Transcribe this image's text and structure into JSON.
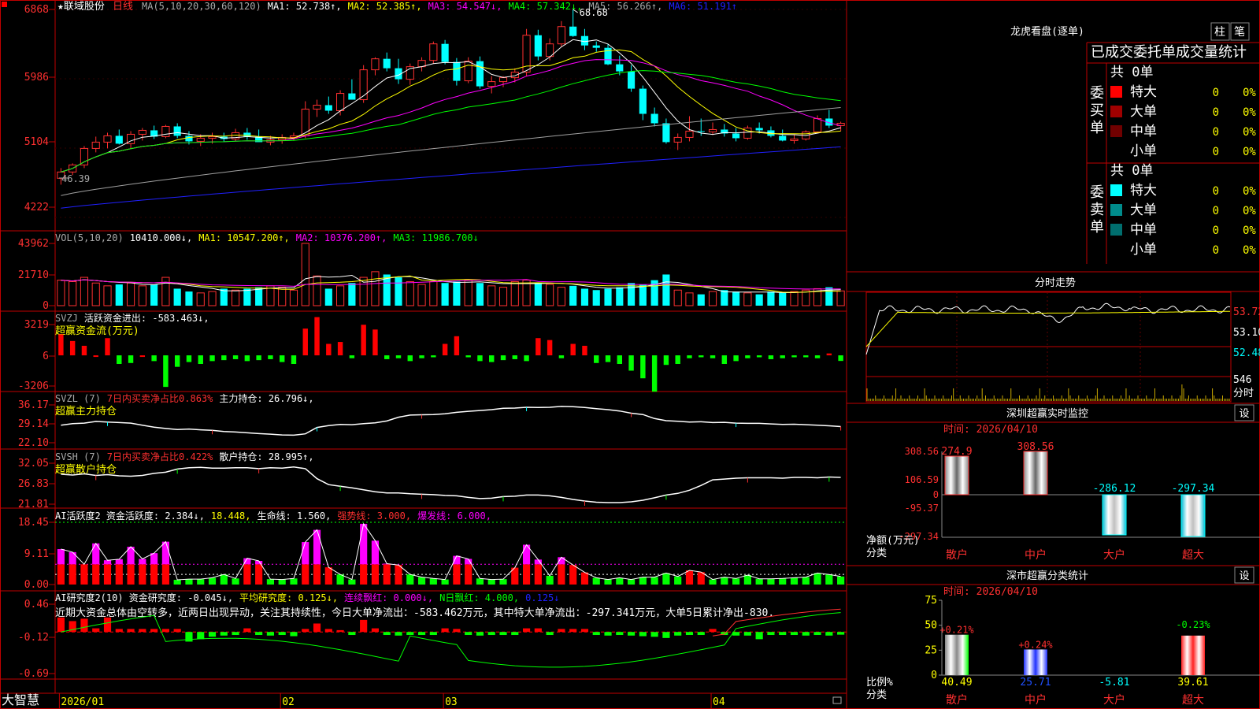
{
  "stock": {
    "name": "★联域股份",
    "period": "日线"
  },
  "colors": {
    "up": "#ff3030",
    "down": "#00ffff",
    "frame": "#c00000",
    "ma1": "#ffffff",
    "ma2": "#ffff00",
    "ma3": "#ff00ff",
    "ma4": "#00ff00",
    "ma5": "#a0a0a0",
    "ma6": "#2020ff",
    "green": "#00ff00",
    "magenta": "#ff00ff",
    "yellow": "#ffff00",
    "cyan": "#00ffff",
    "text": "#ffffff",
    "grey": "#aaaaaa"
  },
  "price_panel": {
    "header": [
      {
        "t": "MA(5,10,20,30,60,120)",
        "c": "grey"
      },
      {
        "t": "MA1: 52.738↑,",
        "c": "ma1"
      },
      {
        "t": "MA2: 52.385↑,",
        "c": "ma2"
      },
      {
        "t": "MA3: 54.547↓,",
        "c": "ma3"
      },
      {
        "t": "MA4: 57.342↓,",
        "c": "ma4"
      },
      {
        "t": "MA5: 56.266↑,",
        "c": "grey"
      },
      {
        "t": "MA6: 51.191↑",
        "c": "ma6"
      }
    ],
    "yticks": [
      "6868",
      "5986",
      "5104",
      "4222"
    ],
    "high_label": "68.68",
    "low_label": "46.39"
  },
  "vol_panel": {
    "header": [
      {
        "t": "VOL(5,10,20)",
        "c": "grey"
      },
      {
        "t": "10410.000↓,",
        "c": "ma1"
      },
      {
        "t": "MA1: 10547.200↑,",
        "c": "ma2"
      },
      {
        "t": "MA2: 10376.200↑,",
        "c": "ma3"
      },
      {
        "t": "MA3: 11986.700↓",
        "c": "ma4"
      }
    ],
    "yticks": [
      "43962",
      "21710",
      "0"
    ]
  },
  "svzj_panel": {
    "header": [
      {
        "t": "SVZJ",
        "c": "grey"
      },
      {
        "t": "活跃资金进出: -583.463↓,",
        "c": "text"
      }
    ],
    "subtitle": "超赢资金流(万元)",
    "yticks": [
      "3219",
      "6",
      "-3206"
    ]
  },
  "svzl_panel": {
    "header": [
      {
        "t": "SVZL (7)",
        "c": "grey"
      },
      {
        "t": "7日内买卖净占比0.863%",
        "c": "up"
      },
      {
        "t": "主力持仓: 26.796↓,",
        "c": "text"
      }
    ],
    "subtitle": "超赢主力持仓",
    "yticks": [
      "36.17",
      "29.14",
      "22.10"
    ]
  },
  "svsh_panel": {
    "header": [
      {
        "t": "SVSH (7)",
        "c": "grey"
      },
      {
        "t": "7日内买卖净占比0.422%",
        "c": "up"
      },
      {
        "t": "散户持仓: 28.995↑,",
        "c": "text"
      }
    ],
    "subtitle": "超赢散户持仓",
    "yticks": [
      "32.05",
      "26.83",
      "21.81"
    ]
  },
  "ai1_panel": {
    "header": [
      {
        "t": "AI活跃度2 资金活跃度: 2.384↓,",
        "c": "text"
      },
      {
        "t": "18.448,",
        "c": "ma2"
      },
      {
        "t": "生命线: 1.560,",
        "c": "text"
      },
      {
        "t": "强势线: 3.000,",
        "c": "up"
      },
      {
        "t": "爆发线: 6.000,",
        "c": "magenta"
      }
    ],
    "yticks": [
      "18.45",
      "9.11",
      "0.00"
    ]
  },
  "ai2_panel": {
    "header": [
      {
        "t": "AI研究度2(10) 资金研究度: -0.045↓,",
        "c": "text"
      },
      {
        "t": "平均研究度: 0.125↓,",
        "c": "ma2"
      },
      {
        "t": "连续飘红: 0.000↓,",
        "c": "magenta"
      },
      {
        "t": "N日飘红: 4.000,",
        "c": "green"
      },
      {
        "t": "0.125↓",
        "c": "ma6"
      }
    ],
    "text": "近期大资金总体由空转多，近两日出现异动，关注其持续性，今日大单净流出：-583.462万元，其中特大单净流出：-297.341万元，大单5日累计净出-830.",
    "yticks": [
      "0.46",
      "-0.12",
      "-0.69"
    ]
  },
  "xaxis": {
    "logo": "大智慧",
    "labels": [
      {
        "t": "2026/01",
        "x": 0
      },
      {
        "t": "02",
        "x": 19
      },
      {
        "t": "03",
        "x": 33
      },
      {
        "t": "04",
        "x": 56
      }
    ]
  },
  "dragon": {
    "title": "龙虎看盘(逐单)",
    "tabs": [
      "柱",
      "笔"
    ],
    "heading": "已成交委托单成交量统计",
    "buy_label": "委买单",
    "sell_label": "委卖单",
    "buy_total": "共 0单",
    "sell_total": "共 0单",
    "buy_rows": [
      {
        "name": "特大",
        "vol": "0",
        "pct": "0%",
        "color": "#ff0000"
      },
      {
        "name": "大单",
        "vol": "0",
        "pct": "0%",
        "color": "#a00000"
      },
      {
        "name": "中单",
        "vol": "0",
        "pct": "0%",
        "color": "#700000"
      },
      {
        "name": "小单",
        "vol": "0",
        "pct": "0%",
        "color": ""
      }
    ],
    "sell_rows": [
      {
        "name": "特大",
        "vol": "0",
        "pct": "0%",
        "color": "#00ffff"
      },
      {
        "name": "大单",
        "vol": "0",
        "pct": "0%",
        "color": "#008c8c"
      },
      {
        "name": "中单",
        "vol": "0",
        "pct": "0%",
        "color": "#006e6e"
      },
      {
        "name": "小单",
        "vol": "0",
        "pct": "0%",
        "color": ""
      }
    ]
  },
  "minute": {
    "title": "分时走势",
    "ylabels": [
      "53.72",
      "53.10",
      "52.48"
    ],
    "vol_label": "546",
    "vol_unit": "分时"
  },
  "sz_monitor": {
    "title": "深圳超赢实时监控",
    "settings": "设",
    "time": "时间: 2026/04/10",
    "yticks": [
      "308.56",
      "106.59",
      "0",
      "-95.37",
      "-297.34"
    ],
    "ylabel": "净额(万元)",
    "xlabel": "分类",
    "cats": [
      "散户",
      "中户",
      "大户",
      "超大"
    ],
    "vals": [
      274.9,
      308.56,
      -286.12,
      -297.34
    ],
    "val_labels": [
      "274.9",
      "308.56",
      "-286.12",
      "-297.34"
    ]
  },
  "sz_class": {
    "title": "深市超赢分类统计",
    "settings": "设",
    "time": "时间: 2026/04/10",
    "yticks": [
      "75",
      "50",
      "25",
      "0"
    ],
    "ylabel": "比例%",
    "xlabel": "分类",
    "cats": [
      "散户",
      "中户",
      "大户",
      "超大"
    ],
    "vals": [
      40.49,
      25.71,
      -5.81,
      39.61
    ],
    "val_labels": [
      "40.49",
      "25.71",
      "-5.81",
      "39.61"
    ],
    "chg_labels": [
      "+0.21%",
      "+0.24%",
      "",
      "-0.23%"
    ]
  },
  "chart_data": [
    {
      "type": "candlestick",
      "title": "联域股份 日线",
      "x": [
        "2026/01",
        "02",
        "03",
        "04"
      ],
      "ylim": [
        42.22,
        68.68
      ],
      "ohlc": [
        [
          47.2,
          48.5,
          46.39,
          48.0
        ],
        [
          48.0,
          49.1,
          47.6,
          48.9
        ],
        [
          48.9,
          51.3,
          48.5,
          51.0
        ],
        [
          51.0,
          52.5,
          50.5,
          51.8
        ],
        [
          51.8,
          53.0,
          51.0,
          52.6
        ],
        [
          52.6,
          53.4,
          51.5,
          51.6
        ],
        [
          51.6,
          53.2,
          51.0,
          52.8
        ],
        [
          52.8,
          53.6,
          52.0,
          53.3
        ],
        [
          53.3,
          53.9,
          52.2,
          52.5
        ],
        [
          52.5,
          54.0,
          52.3,
          53.8
        ],
        [
          53.8,
          54.2,
          52.3,
          52.6
        ],
        [
          52.6,
          53.2,
          51.5,
          51.9
        ],
        [
          51.9,
          52.8,
          51.3,
          52.3
        ],
        [
          52.3,
          53.0,
          51.6,
          52.5
        ],
        [
          52.5,
          53.0,
          51.8,
          52.2
        ],
        [
          52.2,
          53.5,
          51.9,
          53.0
        ],
        [
          53.0,
          53.6,
          52.1,
          52.5
        ],
        [
          52.5,
          53.4,
          52.0,
          51.8
        ],
        [
          51.8,
          52.6,
          51.4,
          52.1
        ],
        [
          52.1,
          52.8,
          51.6,
          52.4
        ],
        [
          52.4,
          53.0,
          52.0,
          52.6
        ],
        [
          52.6,
          57.0,
          52.3,
          56.0
        ],
        [
          56.0,
          57.2,
          55.0,
          56.5
        ],
        [
          56.5,
          57.6,
          55.4,
          55.8
        ],
        [
          55.8,
          58.4,
          55.2,
          58.0
        ],
        [
          58.0,
          59.8,
          57.2,
          57.2
        ],
        [
          57.2,
          61.6,
          56.8,
          61.0
        ],
        [
          61.0,
          62.6,
          60.3,
          62.4
        ],
        [
          62.4,
          63.2,
          60.8,
          61.2
        ],
        [
          61.2,
          62.4,
          59.2,
          59.8
        ],
        [
          59.8,
          61.8,
          59.1,
          61.4
        ],
        [
          61.4,
          62.6,
          60.8,
          62.2
        ],
        [
          62.2,
          64.6,
          61.8,
          64.3
        ],
        [
          64.3,
          64.8,
          61.7,
          62.0
        ],
        [
          62.0,
          62.5,
          59.0,
          59.6
        ],
        [
          59.6,
          62.6,
          59.3,
          62.1
        ],
        [
          62.1,
          62.7,
          58.6,
          58.9
        ],
        [
          58.9,
          60.2,
          58.0,
          59.5
        ],
        [
          59.5,
          60.2,
          58.8,
          60.0
        ],
        [
          60.0,
          61.2,
          59.4,
          60.7
        ],
        [
          60.7,
          66.2,
          60.2,
          65.4
        ],
        [
          65.4,
          66.1,
          62.2,
          62.7
        ],
        [
          62.7,
          65.0,
          62.2,
          64.3
        ],
        [
          64.3,
          67.2,
          63.9,
          66.5
        ],
        [
          66.5,
          68.68,
          65.2,
          65.3
        ],
        [
          65.3,
          66.2,
          63.5,
          64.1
        ],
        [
          64.1,
          64.6,
          63.3,
          63.8
        ],
        [
          63.8,
          64.3,
          61.6,
          61.7
        ],
        [
          61.7,
          62.8,
          60.3,
          60.8
        ],
        [
          60.8,
          61.6,
          58.2,
          58.6
        ],
        [
          58.6,
          59.0,
          54.6,
          55.4
        ],
        [
          55.4,
          56.2,
          53.8,
          54.2
        ],
        [
          54.2,
          54.8,
          51.6,
          51.8
        ],
        [
          51.8,
          52.9,
          50.8,
          52.4
        ],
        [
          52.4,
          55.1,
          51.9,
          53.2
        ],
        [
          53.2,
          54.8,
          52.6,
          53.1
        ],
        [
          53.1,
          54.3,
          52.7,
          53.4
        ],
        [
          53.4,
          54.1,
          52.5,
          52.9
        ],
        [
          52.9,
          53.6,
          51.9,
          52.3
        ],
        [
          52.3,
          53.9,
          52.1,
          53.6
        ],
        [
          53.6,
          54.3,
          52.9,
          53.3
        ],
        [
          53.3,
          53.8,
          52.4,
          52.6
        ],
        [
          52.6,
          53.4,
          51.9,
          52.0
        ],
        [
          52.0,
          52.7,
          51.6,
          52.2
        ],
        [
          52.2,
          53.3,
          52.0,
          53.1
        ],
        [
          53.1,
          55.2,
          52.9,
          54.8
        ],
        [
          54.8,
          55.9,
          53.6,
          53.9
        ],
        [
          53.9,
          54.4,
          53.2,
          54.2
        ]
      ]
    },
    {
      "type": "bar",
      "title": "VOL",
      "ylim": [
        0,
        43962
      ],
      "values": [
        18000,
        17000,
        20000,
        16000,
        14000,
        15000,
        16000,
        14000,
        15000,
        20000,
        12000,
        10000,
        9000,
        10000,
        12000,
        11000,
        12000,
        13000,
        14000,
        13000,
        11000,
        44000,
        21000,
        12000,
        14000,
        16000,
        20000,
        24000,
        22000,
        20000,
        17000,
        15000,
        17000,
        16000,
        17000,
        18000,
        16000,
        14000,
        13000,
        17000,
        18000,
        16000,
        15000,
        13000,
        14000,
        12000,
        11000,
        12000,
        13000,
        16000,
        15000,
        18000,
        22000,
        11000,
        9000,
        8000,
        10000,
        11000,
        10000,
        9000,
        8000,
        10000,
        9000,
        10000,
        11000,
        12000,
        13000,
        10410
      ]
    },
    {
      "type": "bar",
      "title": "超赢资金流(万元)",
      "ylim": [
        -3206,
        3219
      ],
      "values": [
        2200,
        1500,
        1000,
        0,
        1800,
        -900,
        -800,
        0,
        -600,
        -3300,
        -1200,
        -700,
        -900,
        -600,
        -500,
        -400,
        -600,
        -500,
        -400,
        -700,
        -900,
        2800,
        4000,
        1200,
        1400,
        -300,
        3200,
        2700,
        -400,
        -300,
        -600,
        -300,
        -200,
        1200,
        2000,
        -200,
        -600,
        -700,
        -500,
        -400,
        -600,
        1800,
        1600,
        -300,
        1200,
        1000,
        -800,
        -700,
        -900,
        -1600,
        -2400,
        -3800,
        -1000,
        -900,
        -300,
        -200,
        -300,
        -900,
        -600,
        -300,
        -200,
        -400,
        -300,
        -200,
        -200,
        -300,
        200,
        -583
      ]
    },
    {
      "type": "line",
      "title": "超赢主力持仓",
      "ylim": [
        22.1,
        36.17
      ],
      "values": [
        28.6,
        29.2,
        29.4,
        30.0,
        29.8,
        29.6,
        29.4,
        28.6,
        27.9,
        27.4,
        27.0,
        27.2,
        26.9,
        26.7,
        26.3,
        26.1,
        25.8,
        25.5,
        25.3,
        25.0,
        24.9,
        25.4,
        27.8,
        28.5,
        28.9,
        28.8,
        29.2,
        29.5,
        30.2,
        31.6,
        32.4,
        32.5,
        32.6,
        32.9,
        33.4,
        33.8,
        34.1,
        34.4,
        34.9,
        35.0,
        35.3,
        35.2,
        35.3,
        35.6,
        35.5,
        35.2,
        34.8,
        34.4,
        33.9,
        33.1,
        32.6,
        31.1,
        30.3,
        30.1,
        29.8,
        29.9,
        29.6,
        29.7,
        29.4,
        29.3,
        29.3,
        29.1,
        28.9,
        29.0,
        28.8,
        28.6,
        28.4,
        28.1
      ]
    },
    {
      "type": "line",
      "title": "超赢散户持仓",
      "ylim": [
        21.81,
        32.05
      ],
      "values": [
        29.3,
        29.1,
        29.4,
        29.0,
        29.2,
        28.9,
        28.8,
        29.0,
        29.5,
        29.8,
        30.6,
        30.9,
        31.0,
        30.8,
        30.8,
        30.9,
        30.9,
        30.7,
        30.9,
        30.8,
        31.1,
        30.7,
        28.2,
        26.7,
        26.3,
        25.9,
        25.4,
        24.9,
        24.6,
        24.6,
        24.4,
        24.3,
        24.2,
        24.0,
        23.9,
        23.5,
        23.2,
        23.3,
        23.7,
        23.8,
        24.1,
        24.1,
        23.9,
        23.5,
        23.0,
        22.6,
        22.3,
        22.2,
        22.2,
        22.4,
        22.8,
        23.4,
        24.1,
        24.5,
        25.3,
        26.5,
        27.9,
        28.1,
        28.3,
        28.4,
        28.4,
        28.4,
        28.3,
        28.5,
        28.5,
        28.4,
        28.6,
        28.5
      ]
    },
    {
      "type": "bar",
      "title": "AI活跃度2",
      "ylim": [
        0,
        18.45
      ],
      "values": [
        10.5,
        9.6,
        6.0,
        12.2,
        7.2,
        7.5,
        11.2,
        7.6,
        9.3,
        12.7,
        1.4,
        1.6,
        1.6,
        2.0,
        3.0,
        1.8,
        7.8,
        7.0,
        1.6,
        1.5,
        1.8,
        12.6,
        16.2,
        5.1,
        3.0,
        1.5,
        18.0,
        13.0,
        6.2,
        5.8,
        3.0,
        2.2,
        1.8,
        1.5,
        8.5,
        7.6,
        1.8,
        1.5,
        1.6,
        5.0,
        11.8,
        7.4,
        2.6,
        8.1,
        5.8,
        3.6,
        2.0,
        1.5,
        2.0,
        1.5,
        2.2,
        2.2,
        3.4,
        2.4,
        4.2,
        3.7,
        1.5,
        2.2,
        1.8,
        2.8,
        1.7,
        1.7,
        1.8,
        2.0,
        2.2,
        3.4,
        3.0,
        2.384
      ]
    },
    {
      "type": "bar",
      "title": "AI研究度2(10)",
      "ylim": [
        -0.69,
        0.46
      ],
      "values": [
        0.24,
        0.18,
        0.22,
        0.06,
        0.24,
        0.05,
        0.05,
        0.05,
        0.05,
        0.05,
        0.05,
        -0.16,
        -0.12,
        -0.08,
        -0.06,
        -0.05,
        0.06,
        -0.05,
        -0.06,
        -0.05,
        -0.07,
        0.05,
        0.14,
        0.05,
        0.03,
        -0.05,
        0.2,
        0.06,
        -0.05,
        -0.06,
        -0.05,
        -0.05,
        -0.05,
        0.06,
        0.05,
        -0.05,
        -0.06,
        -0.05,
        -0.05,
        -0.05,
        0.06,
        0.06,
        -0.05,
        0.05,
        0.05,
        0.05,
        -0.05,
        -0.06,
        -0.05,
        -0.06,
        -0.07,
        -0.08,
        -0.1,
        -0.06,
        -0.05,
        -0.05,
        0.05,
        -0.05,
        -0.06,
        -0.06,
        -0.12,
        -0.05,
        -0.05,
        -0.05,
        -0.06,
        -0.05,
        -0.06,
        -0.045
      ]
    },
    {
      "type": "bar",
      "title": "深圳超赢实时监控",
      "categories": [
        "散户",
        "中户",
        "大户",
        "超大"
      ],
      "values": [
        274.9,
        308.56,
        -286.12,
        -297.34
      ],
      "ylim": [
        -297.34,
        308.56
      ]
    },
    {
      "type": "bar",
      "title": "深市超赢分类统计",
      "categories": [
        "散户",
        "中户",
        "大户",
        "超大"
      ],
      "values": [
        40.49,
        25.71,
        -5.81,
        39.61
      ],
      "ylim": [
        0,
        75
      ]
    }
  ]
}
